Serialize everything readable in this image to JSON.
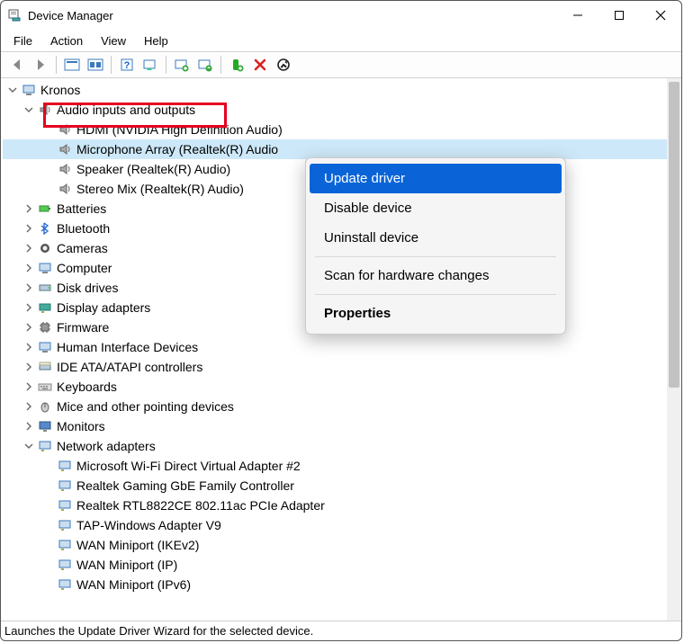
{
  "title": "Device Manager",
  "menubar": {
    "file": "File",
    "action": "Action",
    "view": "View",
    "help": "Help"
  },
  "root": "Kronos",
  "audio_category": "Audio inputs and outputs",
  "audio": {
    "hdmi": "HDMI (NVIDIA High Definition Audio)",
    "mic": "Microphone Array (Realtek(R) Audio",
    "speaker": "Speaker (Realtek(R) Audio)",
    "stereo": "Stereo Mix (Realtek(R) Audio)"
  },
  "categories": {
    "batteries": "Batteries",
    "bluetooth": "Bluetooth",
    "cameras": "Cameras",
    "computer": "Computer",
    "disk": "Disk drives",
    "display": "Display adapters",
    "firmware": "Firmware",
    "hid": "Human Interface Devices",
    "ide": "IDE ATA/ATAPI controllers",
    "keyboards": "Keyboards",
    "mice": "Mice and other pointing devices",
    "monitors": "Monitors",
    "network": "Network adapters"
  },
  "network": {
    "wifidirect": "Microsoft Wi-Fi Direct Virtual Adapter #2",
    "realtek_gbe": "Realtek Gaming GbE Family Controller",
    "realtek_wifi": "Realtek RTL8822CE 802.11ac PCIe Adapter",
    "tap": "TAP-Windows Adapter V9",
    "wan_ikev2": "WAN Miniport (IKEv2)",
    "wan_ip": "WAN Miniport (IP)",
    "wan_ipv6": "WAN Miniport (IPv6)"
  },
  "context_menu": {
    "update": "Update driver",
    "disable": "Disable device",
    "uninstall": "Uninstall device",
    "scan": "Scan for hardware changes",
    "properties": "Properties"
  },
  "statusbar": "Launches the Update Driver Wizard for the selected device."
}
